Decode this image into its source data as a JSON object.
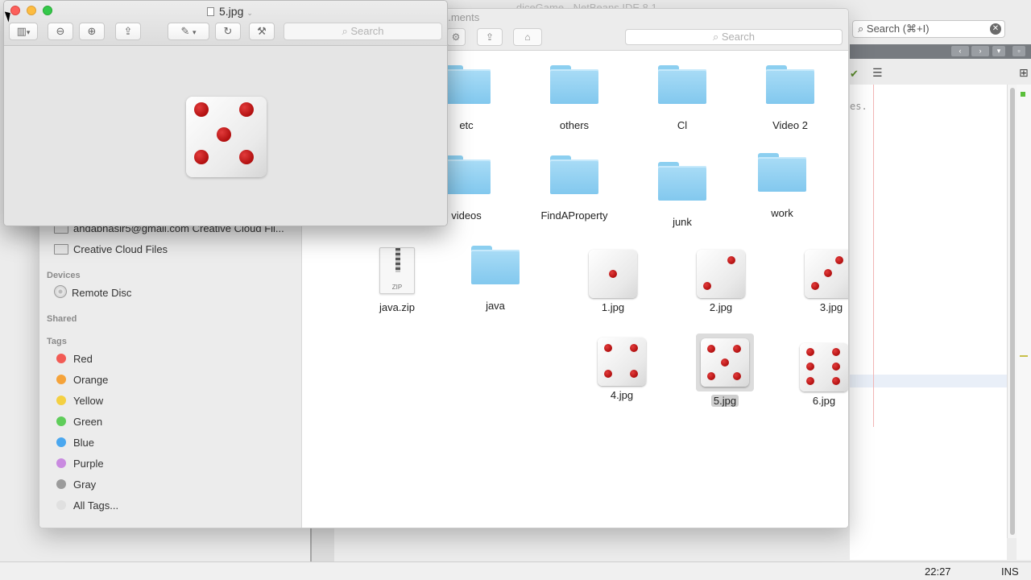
{
  "ide": {
    "title": "...diceGame - NetBeans IDE 8.1",
    "search_placeholder": "Search (⌘+I)",
    "code_fragment": "es.",
    "status": {
      "time": "22:27",
      "mode": "INS"
    }
  },
  "finder": {
    "title": "...ments",
    "search_placeholder": "Search",
    "sidebar": {
      "cloud_items": [
        {
          "label": "andabhasir5@gmail.com Creative Cloud Fil..."
        },
        {
          "label": "Creative Cloud Files"
        }
      ],
      "devices_header": "Devices",
      "devices": [
        {
          "label": "Remote Disc"
        }
      ],
      "shared_header": "Shared",
      "tags_header": "Tags",
      "tags": [
        {
          "label": "Red",
          "color": "#f25b55"
        },
        {
          "label": "Orange",
          "color": "#f5a33a"
        },
        {
          "label": "Yellow",
          "color": "#f4d042"
        },
        {
          "label": "Green",
          "color": "#5fcd5a"
        },
        {
          "label": "Blue",
          "color": "#4aa7ef"
        },
        {
          "label": "Purple",
          "color": "#c98ae0"
        },
        {
          "label": "Gray",
          "color": "#9b9b9b"
        },
        {
          "label": "All Tags...",
          "color": "#e0e0e0"
        }
      ]
    },
    "items": {
      "etc": "etc",
      "others": "others",
      "cl": "Cl",
      "video2": "Video 2",
      "videos": "videos",
      "findaproperty": "FindAProperty",
      "junk": "junk",
      "work": "work",
      "javazip": "java.zip",
      "zip_label": "ZIP",
      "java": "java",
      "img1": "1.jpg",
      "img2": "2.jpg",
      "img3": "3.jpg",
      "img4": "4.jpg",
      "img5": "5.jpg",
      "img6": "6.jpg"
    },
    "selected_item": "5.jpg"
  },
  "preview": {
    "title": "5.jpg",
    "search_placeholder": "Search",
    "image_pips": 5
  }
}
